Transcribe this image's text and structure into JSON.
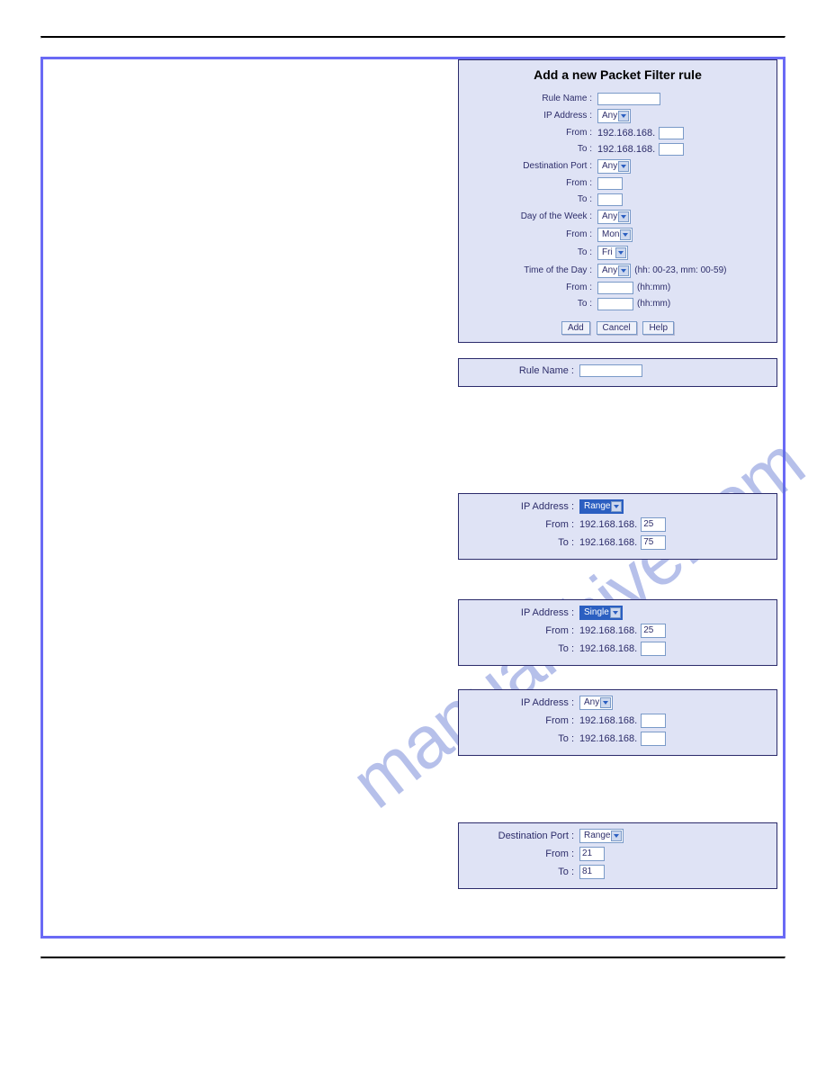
{
  "watermark": "manualshive.com",
  "main_panel": {
    "title": "Add a new Packet Filter rule",
    "fields": {
      "rule_name_label": "Rule Name :",
      "ip_address_label": "IP Address :",
      "ip_address_value": "Any",
      "from_label": "From :",
      "to_label": "To :",
      "ip_prefix": "192.168.168.",
      "dest_port_label": "Destination Port :",
      "dest_port_value": "Any",
      "dow_label": "Day of the Week :",
      "dow_value": "Any",
      "dow_from": "Mon",
      "dow_to": "Fri",
      "tod_label": "Time of the Day :",
      "tod_value": "Any",
      "tod_hint": "(hh: 00-23, mm: 00-59)",
      "hhmm": "(hh:mm)"
    },
    "buttons": {
      "add": "Add",
      "cancel": "Cancel",
      "help": "Help"
    }
  },
  "snip_rulename": {
    "label": "Rule Name :"
  },
  "snip_ip_range": {
    "ip_label": "IP Address :",
    "mode": "Range",
    "from_label": "From :",
    "to_label": "To :",
    "prefix": "192.168.168.",
    "from_val": "25",
    "to_val": "75"
  },
  "snip_ip_single": {
    "ip_label": "IP Address :",
    "mode": "Single",
    "from_label": "From :",
    "to_label": "To :",
    "prefix": "192.168.168.",
    "from_val": "25",
    "to_val": ""
  },
  "snip_ip_any": {
    "ip_label": "IP Address :",
    "mode": "Any",
    "from_label": "From :",
    "to_label": "To :",
    "prefix": "192.168.168.",
    "from_val": "",
    "to_val": ""
  },
  "snip_port_range": {
    "label": "Destination Port :",
    "mode": "Range",
    "from_label": "From :",
    "to_label": "To :",
    "from_val": "21",
    "to_val": "81"
  }
}
